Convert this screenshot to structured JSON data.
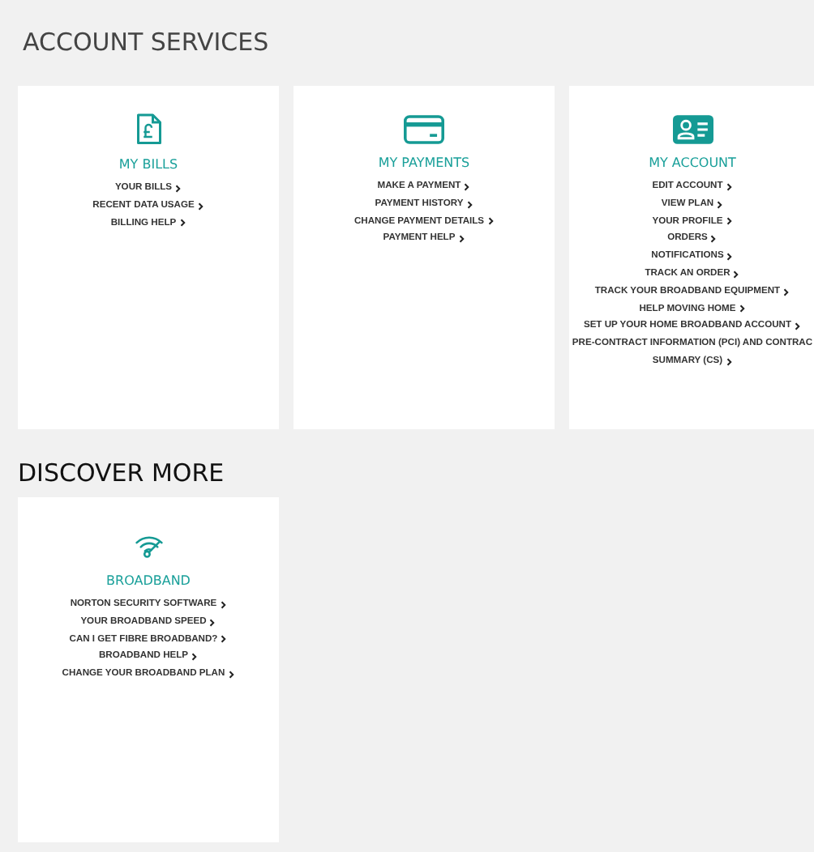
{
  "sections": [
    {
      "title": "ACCOUNT SERVICES",
      "cards": [
        {
          "title": "MY BILLS",
          "links": [
            {
              "text": "YOUR BILLS",
              "chevron": true
            },
            {
              "text": "RECENT DATA USAGE",
              "chevron": true
            },
            {
              "text": "BILLING HELP",
              "chevron": true
            }
          ]
        },
        {
          "title": "MY PAYMENTS",
          "links": [
            {
              "text": "MAKE A PAYMENT",
              "chevron": true
            },
            {
              "text": "PAYMENT HISTORY",
              "chevron": true
            },
            {
              "text": "CHANGE PAYMENT DETAILS",
              "chevron": true
            },
            {
              "text": "PAYMENT HELP",
              "chevron": true
            }
          ]
        },
        {
          "title": "MY ACCOUNT",
          "links": [
            {
              "text": "EDIT ACCOUNT",
              "chevron": true
            },
            {
              "text": "VIEW PLAN",
              "chevron": true
            },
            {
              "text": "YOUR PROFILE",
              "chevron": true
            },
            {
              "text": "ORDERS",
              "chevron": true
            },
            {
              "text": "NOTIFICATIONS",
              "chevron": true
            },
            {
              "text": "TRACK AN ORDER",
              "chevron": true
            },
            {
              "text": "TRACK YOUR BROADBAND EQUIPMENT",
              "chevron": true
            },
            {
              "text": "HELP MOVING HOME",
              "chevron": true
            },
            {
              "text": "SET UP YOUR HOME BROADBAND ACCOUNT",
              "chevron": true
            },
            {
              "text": "PRE-CONTRACT INFORMATION (PCI) AND CONTRAC",
              "chevron": false
            },
            {
              "text": "SUMMARY (CS)",
              "chevron": true
            }
          ]
        }
      ]
    },
    {
      "title": "DISCOVER MORE",
      "cards": [
        {
          "title": "BROADBAND",
          "links": [
            {
              "text": "NORTON SECURITY SOFTWARE",
              "chevron": true
            },
            {
              "text": "YOUR BROADBAND SPEED",
              "chevron": true
            },
            {
              "text": "CAN I GET FIBRE BROADBAND?",
              "chevron": true
            },
            {
              "text": "BROADBAND HELP",
              "chevron": true
            },
            {
              "text": "CHANGE YOUR BROADBAND PLAN",
              "chevron": true
            }
          ]
        }
      ]
    }
  ]
}
